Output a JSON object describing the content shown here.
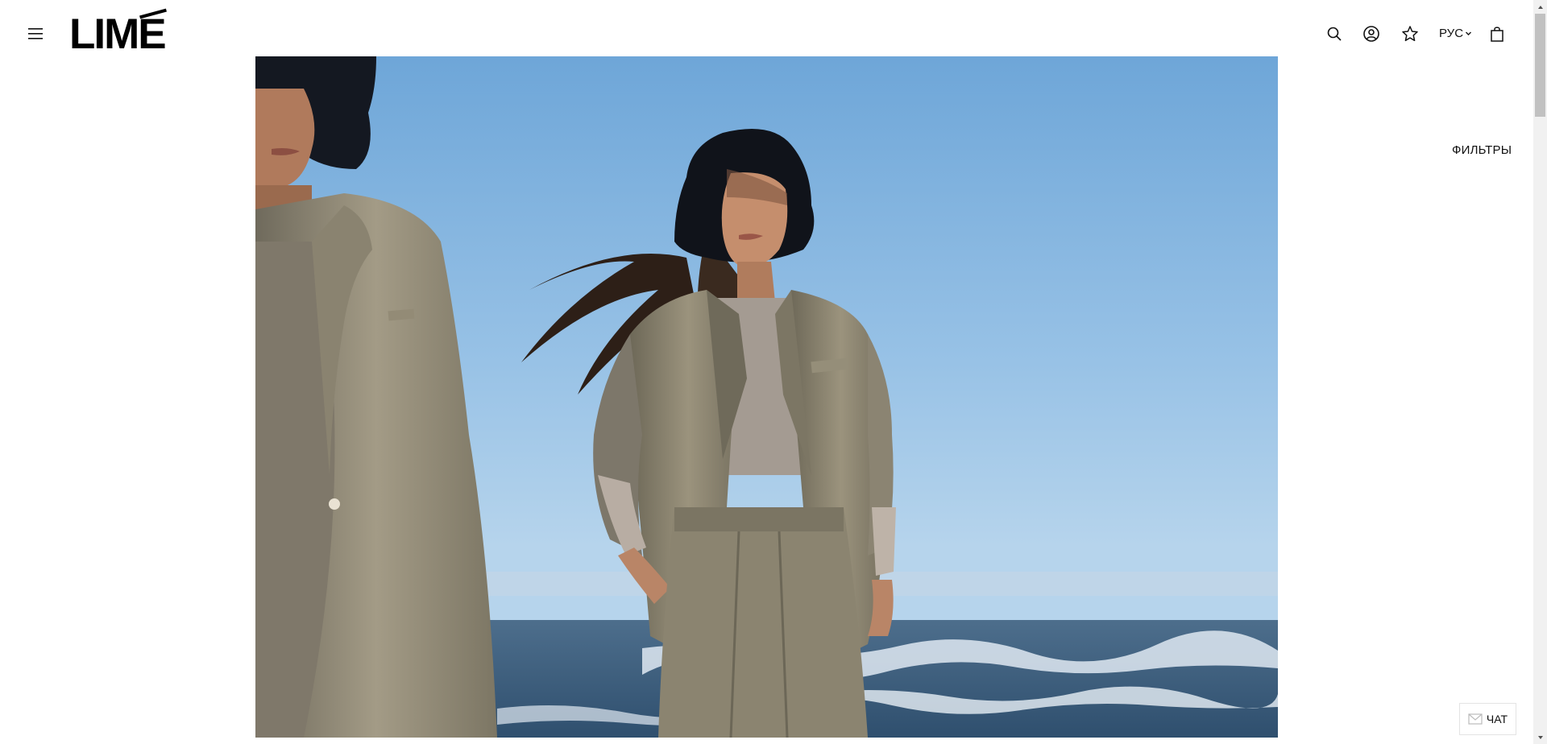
{
  "header": {
    "logo_text": "LIME",
    "language": "РУС",
    "icons": [
      "menu-icon",
      "search-icon",
      "user-icon",
      "star-icon",
      "bag-icon"
    ]
  },
  "hero": {
    "image": "campaign-photo-two-models-beige-suits-black-bucket-hats-seaside"
  },
  "filters": {
    "label": "ФИЛЬТРЫ"
  },
  "chat": {
    "label": "ЧАТ"
  },
  "colors": {
    "text": "#111111",
    "background": "#ffffff",
    "sky": "#8cb7df",
    "suit": "#8e8775",
    "sea": "#3d5f7e"
  }
}
